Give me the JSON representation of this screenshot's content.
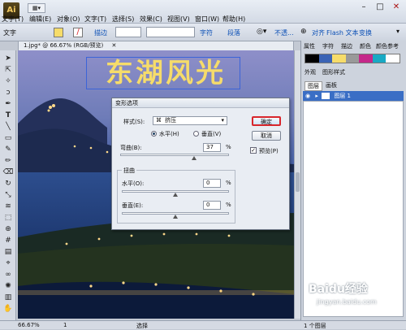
{
  "app": {
    "logo": "Ai",
    "menus": [
      "文字(T)",
      "编辑(E)",
      "对象(O)",
      "文字(T)",
      "选择(S)",
      "效果(C)",
      "视图(V)",
      "窗口(W)",
      "帮助(H)"
    ]
  },
  "window_controls": {
    "minimize": "–",
    "restore": "□",
    "close": "✕"
  },
  "control_bar": {
    "tool_label": "文字",
    "stroke_label": "描边",
    "char_label": "字符",
    "para_label": "段落",
    "opacity_label": "不透...",
    "align_label": "对齐",
    "flash_text_label": "Flash 文本",
    "transform_label": "变换"
  },
  "document": {
    "tab_title": "1.jpg* @ 66.67% (RGB/预览)",
    "artwork_text": "东湖风光"
  },
  "status_bar": {
    "zoom": "66.67%",
    "page": "1",
    "tool_status": "选择"
  },
  "right_panel": {
    "top_tabs": [
      "属性",
      "字符",
      "描边",
      "颜色",
      "颜色参考"
    ],
    "mid_tabs": [
      "外观",
      "图形样式"
    ],
    "layer_tabs": [
      "图层",
      "画板"
    ],
    "layer_name": "图层 1",
    "layer_count": "1 个图层"
  },
  "dialog": {
    "title": "变形选项",
    "style_label": "样式(S):",
    "style_value": "挤压",
    "horizontal_label": "水平(H)",
    "vertical_label": "垂直(V)",
    "horizontal_selected": true,
    "bend_label": "弯曲(B):",
    "bend_value": "37",
    "bend_percent": 37,
    "distortion_group": "扭曲",
    "horiz_distort_label": "水平(O):",
    "horiz_distort_value": "0",
    "vert_distort_label": "垂直(E):",
    "vert_distort_value": "0",
    "percent_sign": "%",
    "ok_label": "确定",
    "cancel_label": "取消",
    "preview_label": "预览(P)",
    "preview_checked": true
  },
  "watermark": {
    "text": "Baidu经验",
    "url": "jingyan.baidu.com"
  },
  "colors": {
    "accent_red": "#d8262c",
    "artwork_yellow": "#f6dc6a",
    "swatch_cyan": "#19a9c4"
  }
}
